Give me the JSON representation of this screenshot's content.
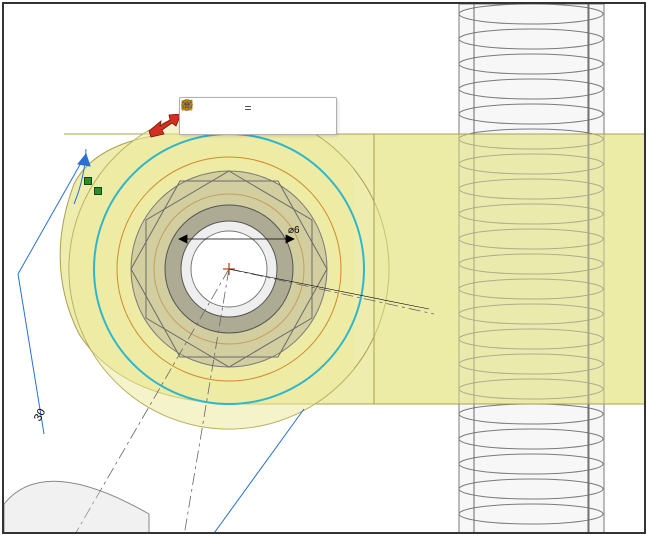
{
  "dimensions": {
    "leader_length": "30",
    "diameter_small": "⌀6"
  },
  "toolbar": {
    "eq_label": "=",
    "icons_row1": [
      "sketch-circle-icon",
      "sketch-arc-icon",
      "sketch-point-icon"
    ],
    "icons_row2": [
      "constraint-coincident-icon",
      "constraint-vertical-icon",
      "constraint-dimension-icon",
      "constraint-tangent-icon",
      "constraint-parallel-icon",
      "constraint-equal-icon",
      "constraint-fix-icon",
      "constraint-symmetric-icon"
    ]
  },
  "cursor": {
    "type": "drag-arrow"
  },
  "colors": {
    "part_face": "#e9e49a",
    "part_face_dark": "#d8d27a",
    "wire_gray": "#8a8a8a",
    "wire_dark": "#5a5a5a",
    "sketch_blue": "#2a6fd6",
    "select_cyan": "#2fb7c9",
    "ref_orange": "#d08a2a",
    "center_red": "#d06030"
  }
}
